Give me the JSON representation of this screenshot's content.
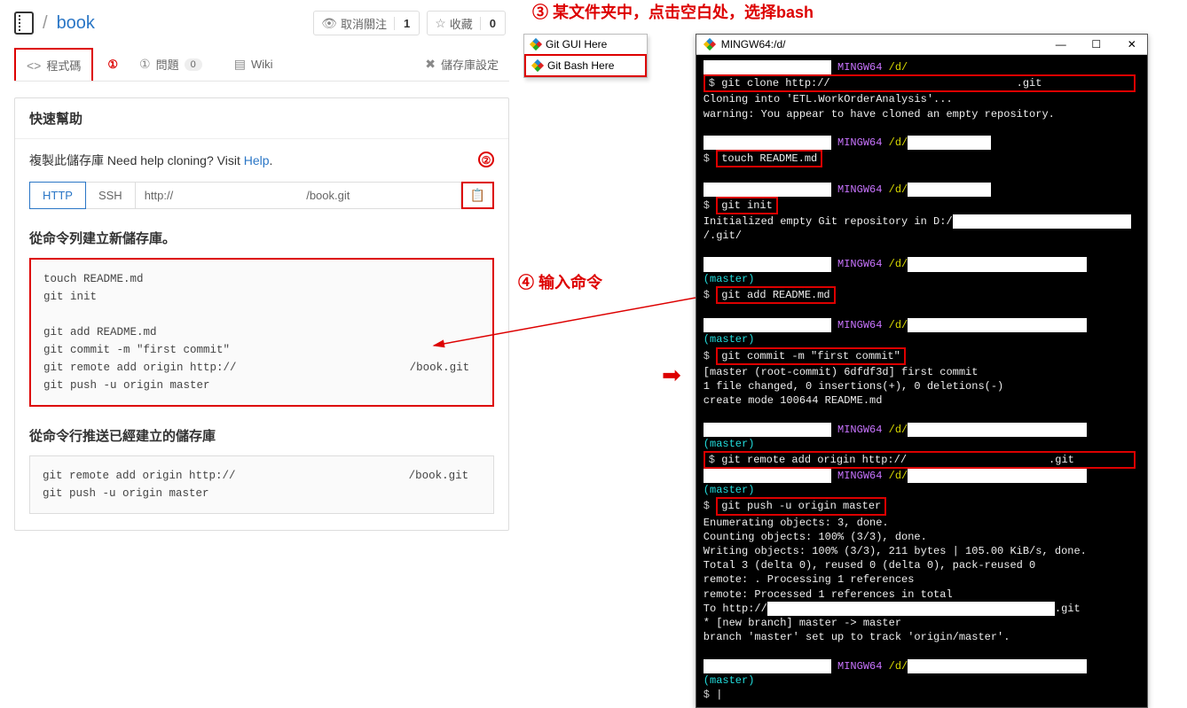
{
  "repo": {
    "name": "book",
    "slash": "/"
  },
  "buttons": {
    "unwatch": "取消關注",
    "unwatch_count": "1",
    "star": "收藏",
    "star_count": "0"
  },
  "tabs": {
    "code": "程式碼",
    "issues": "問題",
    "issues_count": "0",
    "wiki": "Wiki",
    "settings": "儲存庫設定"
  },
  "card": {
    "title": "快速幫助",
    "clone_label": "複製此儲存庫",
    "clone_help_prefix": "Need help cloning? Visit ",
    "clone_help_link": "Help",
    "clone_help_dot": ".",
    "http": "HTTP",
    "ssh": "SSH",
    "url_prefix": "http://",
    "url_suffix": "/book.git",
    "sect1": "從命令列建立新儲存庫。",
    "code1": "touch README.md\ngit init\n\ngit add README.md\ngit commit -m \"first commit\"\ngit remote add origin http://                          /book.git\ngit push -u origin master",
    "sect2": "從命令行推送已經建立的儲存庫",
    "code2": "git remote add origin http://                          /book.git\ngit push -u origin master"
  },
  "annot": {
    "circle1": "①",
    "circle2": "②",
    "circle3_text": "③ 某文件夹中，点击空白处，选择bash",
    "circle4_text": "④ 输入命令"
  },
  "menu": {
    "gui": "Git GUI Here",
    "bash": "Git Bash Here"
  },
  "arrow": "➡",
  "term": {
    "title": "MINGW64:/d/",
    "min": "—",
    "max": "☐",
    "close": "✕",
    "prompt_user": "MINGW64",
    "prompt_path": "/d/",
    "master": "(master)",
    "dollar": "$",
    "l_clone": "git clone http://",
    "l_clone_suffix": ".git",
    "l_cloning": "Cloning into 'ETL.WorkOrderAnalysis'...",
    "l_warn": "warning: You appear to have cloned an empty repository.",
    "l_touch": "touch README.md",
    "l_init": "git init",
    "l_init_out1": "Initialized empty Git repository in D:/",
    "l_init_out2": "/.git/",
    "l_add": "git add README.md",
    "l_commit": "git commit -m \"first commit\"",
    "l_commit_out1": "[master (root-commit) 6dfdf3d] first commit",
    "l_commit_out2": " 1 file changed, 0 insertions(+), 0 deletions(-)",
    "l_commit_out3": " create mode 100644 README.md",
    "l_remote": "git remote add origin http://",
    "l_remote_suffix": ".git",
    "l_push": "git push -u origin master",
    "l_push_out1": "Enumerating objects: 3, done.",
    "l_push_out2": "Counting objects: 100% (3/3), done.",
    "l_push_out3": "Writing objects: 100% (3/3), 211 bytes | 105.00 KiB/s, done.",
    "l_push_out4": "Total 3 (delta 0), reused 0 (delta 0), pack-reused 0",
    "l_push_out5": "remote: . Processing 1 references",
    "l_push_out6": "remote: Processed 1 references in total",
    "l_push_out7a": "To http://",
    "l_push_out7b": ".git",
    "l_push_out8": " * [new branch]      master -> master",
    "l_push_out9": "branch 'master' set up to track 'origin/master'.",
    "cursor": "|"
  }
}
